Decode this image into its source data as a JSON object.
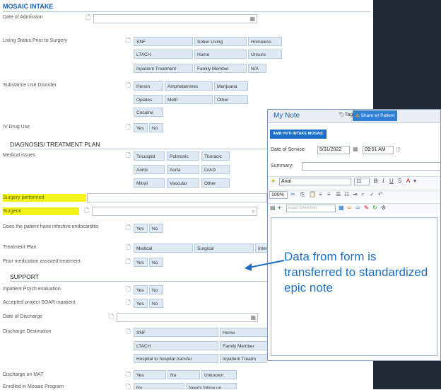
{
  "form": {
    "title": "MOSAIC INTAKE",
    "date_of_admission": "Date of Admission",
    "living_status": {
      "label": "Living Status Prior to Surgery",
      "options": [
        "SNF",
        "Sober Living",
        "Homeless",
        "LTACH",
        "Home",
        "Unsure",
        "Inpatient Treatment",
        "Family Member",
        "N/A"
      ]
    },
    "substance_use": {
      "label": "Substance Use Disorder",
      "options": [
        "Heroin",
        "Amphetamines",
        "Marijuana",
        "Opiates",
        "Meth",
        "Other",
        "Cocaine"
      ]
    },
    "iv_drug_use": {
      "label": "IV Drug Use",
      "options": [
        "Yes",
        "No"
      ]
    },
    "section_diagnosis": "DIAGNOSIS/ TREATMENT PLAN",
    "medical_issues": {
      "label": "Medical issues",
      "options": [
        "Tricuspid",
        "Pulmonic",
        "Thoracic",
        "Aortic",
        "Aorta",
        "LVAD",
        "Mitral",
        "Vascular",
        "Other"
      ]
    },
    "surgery_performed": "Surgery performed",
    "surgeon": "Surgeon",
    "infective_endocarditis": {
      "label": "Does the patient have infective endocarditis",
      "options": [
        "Yes",
        "No"
      ]
    },
    "treatment_plan": {
      "label": "Treatment Plan",
      "options": [
        "Medical",
        "Surgical",
        "Inter"
      ]
    },
    "prior_medication": {
      "label": "Prior medication assisted treatment",
      "options": [
        "Yes",
        "No"
      ]
    },
    "section_support": "SUPPORT",
    "inpatient_psych": {
      "label": "Inpatient Psych evaluation",
      "options": [
        "Yes",
        "No"
      ]
    },
    "soar": {
      "label": "Accepted project SOAR inpatient",
      "options": [
        "Yes",
        "No"
      ]
    },
    "date_of_discharge": "Date of Discharge",
    "discharge_destination": {
      "label": "Discharge Destination",
      "options": [
        "SNF",
        "Home",
        "LTACH",
        "Family Member",
        "Hospital to hospital transfer",
        "Inpatient Treatm"
      ]
    },
    "discharge_on_mat": {
      "label": "Discharge on MAT",
      "options": [
        "Yes",
        "No",
        "Unknown"
      ]
    },
    "enrolled_mosaic": {
      "label": "Enrolled in Mosaic Program",
      "options": [
        "No",
        "Needs follow up"
      ]
    }
  },
  "note": {
    "title": "My Note",
    "tag": "Tag",
    "share": "Share w/ Patient",
    "template": "AMB HVTI INTAKE MOSAIC",
    "date_of_service_label": "Date of Service:",
    "date_of_service": "5/31/2022",
    "time": "09:51 AM",
    "summary_label": "Summary:",
    "font": "Arial",
    "font_size": "11",
    "zoom": "100%",
    "smarttext_placeholder": "Insert SmartText",
    "overlay_text": "Data from form is transferred to standardized epic note"
  },
  "colors": {
    "accent": "#1f6fc0",
    "highlight": "#f3f31a",
    "dark_bg": "#232a36"
  }
}
